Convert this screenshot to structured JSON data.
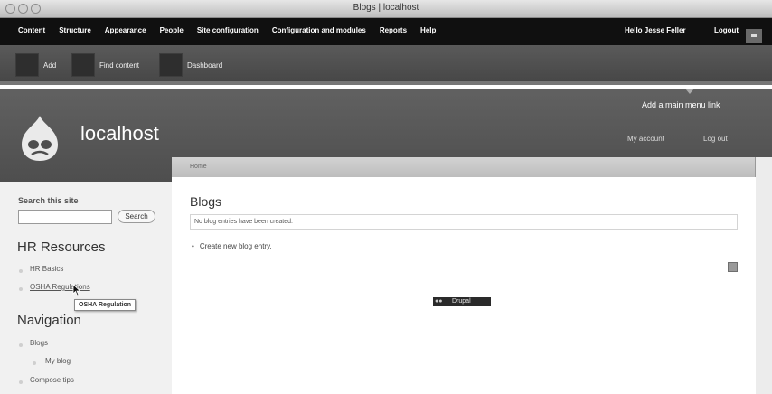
{
  "window": {
    "title": "Blogs | localhost"
  },
  "admin_menu": {
    "items": [
      "Content",
      "Structure",
      "Appearance",
      "People",
      "Site configuration",
      "Configuration and modules",
      "Reports",
      "Help"
    ],
    "hello_prefix": "Hello ",
    "user": "Jesse Feller",
    "logout": "Logout"
  },
  "shortcuts": {
    "items": [
      "Add",
      "Find content",
      "Dashboard"
    ]
  },
  "header": {
    "site_name": "localhost",
    "add_menu_link": "Add a main menu link",
    "my_account": "My account",
    "log_out": "Log out"
  },
  "breadcrumb": "Home",
  "sidebar": {
    "search_label": "Search this site",
    "search_button": "Search",
    "search_value": "",
    "hr_title": "HR Resources",
    "hr_links": [
      "HR Basics",
      "OSHA Regulations"
    ],
    "tooltip": "OSHA Regulation",
    "nav_title": "Navigation",
    "nav_links": [
      "Blogs",
      "My blog",
      "Compose tips"
    ]
  },
  "main": {
    "title": "Blogs",
    "empty_message": "No blog entries have been created.",
    "links": [
      "Create new blog entry."
    ],
    "powered_by": "Drupal"
  }
}
